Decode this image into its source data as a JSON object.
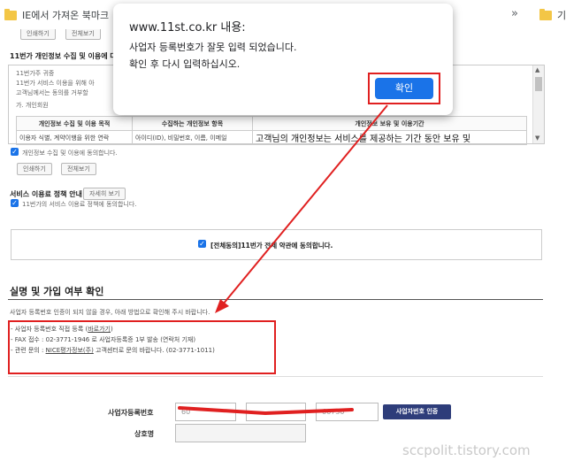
{
  "bookmarks": {
    "folder1": "IE에서 가져온 북마크",
    "folder2": "기",
    "more": "»"
  },
  "dialog": {
    "title": "www.11st.co.kr 내용:",
    "message_line1": "사업자 등록번호가 잘못 입력 되었습니다.",
    "message_line2": "확인 후 다시 입력하십시오.",
    "ok_label": "확인"
  },
  "terms": {
    "top_btn_view": "인쇄하기",
    "top_btn_print": "전체보기",
    "privacy_title": "11번가 개인정보 수집 및 이용에 대",
    "privacy_lines": [
      "11번가주 귀중",
      "11번가 서비스 이용을 위해 아",
      "고객님께서는 동의를 거부할",
      "가. 개인회원"
    ],
    "table_headers": [
      "개인정보 수집 및 이용 목적",
      "수집하는 개인정보 항목",
      "개인정보 보유 및 이용기간"
    ],
    "table_row": [
      "이용자 식별, 계약이행을 위한 연락",
      "아이디(ID), 비밀번호, 이름, 이메일",
      "고객님의 개인정보는 서비스를 제공하는 기간 동안 보유 및"
    ],
    "privacy_agree": "개인정보 수집 및 이용에 동의합니다.",
    "btn_print": "인쇄하기",
    "btn_view": "전체보기",
    "policy_title": "서비스 이용료 정책 안내",
    "policy_btn": "자세히 보기",
    "policy_agree": "11번가의 서비스 이용료 정책에 동의합니다.",
    "agree_all": "[전체동의]11번가 전체 약관에 동의합니다."
  },
  "verify": {
    "section_title": "실명 및 가입 여부 확인",
    "notice": "사업자 등록번호 인증이 되지 않을 경우, 아래 방법으로 확인해 주시 바랍니다.",
    "method1_prefix": "- 사업자 등록번호 직접 등록 (",
    "method1_link": "바로가기",
    "method1_suffix": ")",
    "method2": "- FAX 접수 : 02-3771-1946 로 사업자등록증 1부 발송 (연락처 기재)",
    "method3_prefix": "- 관련 문의 : ",
    "method3_link": "NICE평가정보(주)",
    "method3_suffix": " 고객센터로 문의 바랍니다. (02-3771-1011)",
    "bizno_label": "사업자등록번호",
    "bizno_part1": "60",
    "bizno_part2": "",
    "bizno_part3": "66730",
    "verify_btn": "사업자번호 인증",
    "company_label": "상호명",
    "company_value": ""
  },
  "watermark": "sccpolit.tistory.com",
  "colors": {
    "dialog_button": "#1a73e8",
    "annotation_red": "#e02020",
    "verify_button": "#2e3d7a",
    "checkbox": "#1a73e8"
  },
  "icons": [
    "folder-icon",
    "checkbox-checked-icon",
    "annotation-arrow",
    "scroll-up-icon",
    "scroll-down-icon"
  ]
}
